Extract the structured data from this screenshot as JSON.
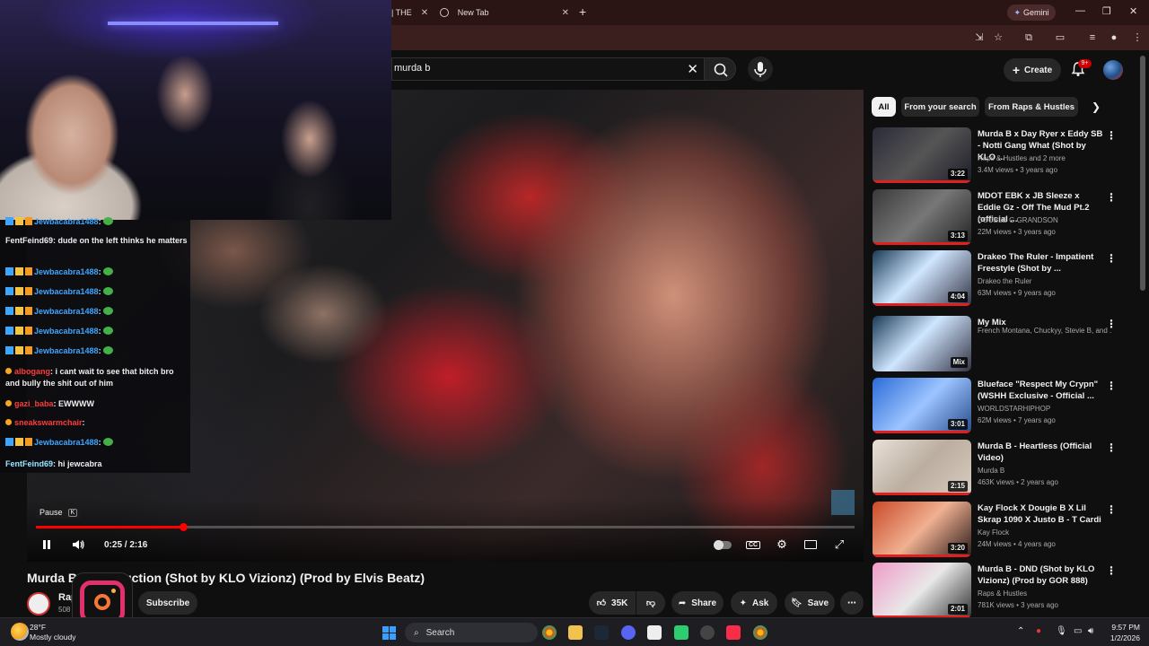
{
  "browser": {
    "tabs": [
      {
        "label": "| THE"
      },
      {
        "label": "New Tab"
      }
    ],
    "gemini_label": "Gemini"
  },
  "youtube_header": {
    "search_query": "murda b",
    "create_label": "Create",
    "notifications_badge": "9+"
  },
  "player": {
    "tooltip_label": "Pause",
    "tooltip_key": "K",
    "time_display": "0:25 / 2:16",
    "progress_fraction": 0.18,
    "title": "Murda B - Introduction (Shot by KLO Vizionz) (Prod by Elvis Beatz)"
  },
  "chat": [
    {
      "user": "Jewbacabra1488",
      "msg": ":",
      "color": "blue",
      "badges": true,
      "emote": true
    },
    {
      "user": "FentFeind69",
      "msg": ": dude on the left thinks he matters",
      "color": "white",
      "badges": false,
      "emote": false
    },
    {
      "user": "Jewbacabra1488",
      "msg": ":",
      "color": "blue",
      "badges": true,
      "emote": true
    },
    {
      "user": "Jewbacabra1488",
      "msg": ":",
      "color": "blue",
      "badges": true,
      "emote": true
    },
    {
      "user": "Jewbacabra1488",
      "msg": ":",
      "color": "blue",
      "badges": true,
      "emote": true
    },
    {
      "user": "Jewbacabra1488",
      "msg": ":",
      "color": "blue",
      "badges": true,
      "emote": true
    },
    {
      "user": "Jewbacabra1488",
      "msg": ":",
      "color": "blue",
      "badges": true,
      "emote": true
    },
    {
      "user": "albogang",
      "msg": ": i cant wait to see that bitch bro and bully the shit out of him",
      "color": "red",
      "badges": false,
      "emote": false
    },
    {
      "user": "gazi_baba",
      "msg": ": EWWWW",
      "color": "red",
      "badges": false,
      "emote": false
    },
    {
      "user": "sneakswarmchair",
      "msg": ":",
      "color": "red",
      "badges": false,
      "emote": false
    },
    {
      "user": "Jewbacabra1488",
      "msg": ":",
      "color": "blue",
      "badges": true,
      "emote": true
    },
    {
      "user": "FentFeind69",
      "msg": ": hi jewcabra",
      "color": "lightblue",
      "badges": false,
      "emote": false
    }
  ],
  "channel": {
    "name": "Raps & Hustles",
    "name_visible": "Raps",
    "subs_visible": "508",
    "subscribe_label": "Subscribe"
  },
  "actions": {
    "likes": "35K",
    "share": "Share",
    "ask": "Ask",
    "save": "Save"
  },
  "chips": [
    {
      "label": "All",
      "active": true
    },
    {
      "label": "From your search",
      "active": false
    },
    {
      "label": "From Raps & Hustles",
      "active": false
    }
  ],
  "recommendations": [
    {
      "title": "Murda B x Day Ryer x Eddy SB - Notti Gang What (Shot by KLO ...",
      "channel": "Raps & Hustles and 2 more",
      "meta": "3.4M views • 3 years ago",
      "duration": "3:22"
    },
    {
      "title": "MDOT EBK x JB Sleeze x Eddie Gz - Off The Mud Pt.2 (official ...",
      "channel": "DOUBLE G GRANDSON",
      "meta": "22M views • 3 years ago",
      "duration": "3:13"
    },
    {
      "title": "Drakeo The Ruler - Impatient Freestyle (Shot by ...",
      "channel": "Drakeo the Ruler",
      "meta": "63M views • 9 years ago",
      "duration": "4:04"
    },
    {
      "title": "My Mix",
      "channel": "French Montana, Chuckyy, Stevie B, and ...",
      "meta": "",
      "duration": "Mix"
    },
    {
      "title": "Blueface \"Respect My Crypn\" (WSHH Exclusive - Official ...",
      "channel": "WORLDSTARHIPHOP",
      "meta": "62M views • 7 years ago",
      "duration": "3:01"
    },
    {
      "title": "Murda B - Heartless (Official Video)",
      "channel": "Murda B",
      "meta": "463K views • 2 years ago",
      "duration": "2:15"
    },
    {
      "title": "Kay Flock X Dougie B X Lil Skrap 1090 X Justo B - T Cardi",
      "channel": "Kay Flock",
      "meta": "24M views • 4 years ago",
      "duration": "3:20"
    },
    {
      "title": "Murda B - DND (Shot by KLO Vizionz) (Prod by GOR 888)",
      "channel": "Raps & Hustles",
      "meta": "781K views • 3 years ago",
      "duration": "2:01"
    }
  ],
  "taskbar": {
    "temp": "28°F",
    "condition": "Mostly cloudy",
    "search_label": "Search",
    "time": "9:57 PM",
    "date": "1/2/2026"
  }
}
